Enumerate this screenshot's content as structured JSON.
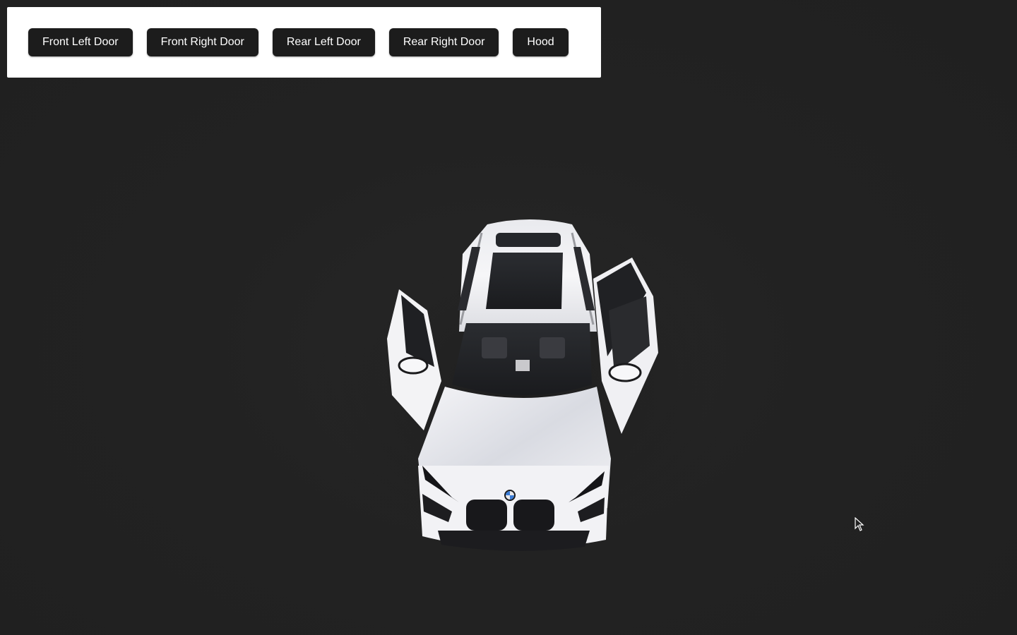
{
  "controls": {
    "buttons": [
      {
        "label": "Front Left Door"
      },
      {
        "label": "Front Right Door"
      },
      {
        "label": "Rear Left Door"
      },
      {
        "label": "Rear Right Door"
      },
      {
        "label": "Hood"
      }
    ]
  },
  "scene": {
    "model": "car-3d-model",
    "background_color": "#222222",
    "car_color": "#f2f2f4",
    "open_parts": [
      "front-left-door",
      "front-right-door"
    ]
  },
  "cursor": {
    "icon": "arrow-cursor-icon"
  }
}
